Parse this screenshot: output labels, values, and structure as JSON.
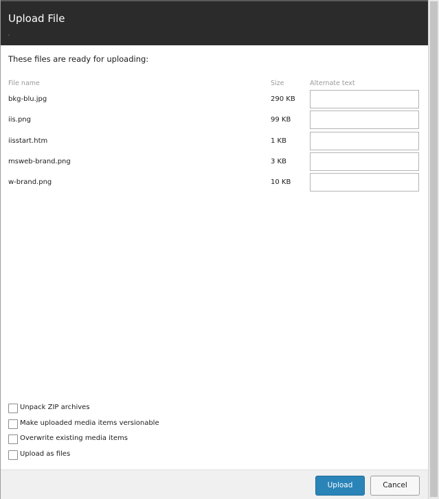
{
  "dialog": {
    "title": "Upload File"
  },
  "intro": "These files are ready for uploading:",
  "columns": {
    "file_name": "File name",
    "size": "Size",
    "alternate_text": "Alternate text"
  },
  "files": [
    {
      "name": "bkg-blu.jpg",
      "size": "290 KB",
      "alternate_text": ""
    },
    {
      "name": "iis.png",
      "size": "99 KB",
      "alternate_text": ""
    },
    {
      "name": "iisstart.htm",
      "size": "1 KB",
      "alternate_text": ""
    },
    {
      "name": "msweb-brand.png",
      "size": "3 KB",
      "alternate_text": ""
    },
    {
      "name": "w-brand.png",
      "size": "10 KB",
      "alternate_text": ""
    }
  ],
  "options": [
    {
      "label": "Unpack ZIP archives",
      "checked": false
    },
    {
      "label": "Make uploaded media items versionable",
      "checked": false
    },
    {
      "label": "Overwrite existing media items",
      "checked": false
    },
    {
      "label": "Upload as files",
      "checked": false
    }
  ],
  "buttons": {
    "upload": "Upload",
    "cancel": "Cancel"
  },
  "colors": {
    "title_bar": "#2b2b2b",
    "primary_button": "#2a84b8"
  }
}
